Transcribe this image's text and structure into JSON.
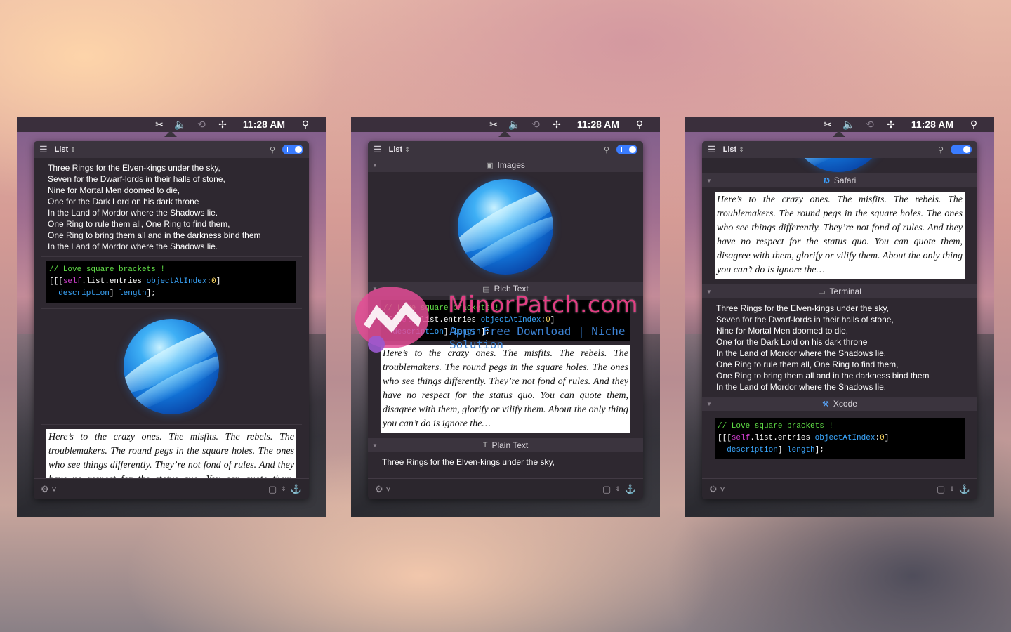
{
  "menubar": {
    "time": "11:28 AM"
  },
  "panel": {
    "title": "List"
  },
  "poem": [
    "Three Rings for the Elven-kings under the sky,",
    "Seven for the Dwarf-lords in their halls of stone,",
    "Nine for Mortal Men doomed to die,",
    "One for the Dark Lord on his dark throne",
    "In the Land of Mordor where the Shadows lie.",
    "One Ring to rule them all, One Ring to find them,",
    "One Ring to bring them all and in the darkness bind them",
    "In the Land of Mordor where the Shadows lie."
  ],
  "code": {
    "comment": "// Love square brackets !",
    "l2_open": "[[[",
    "l2_self": "self",
    "l2_mid": ".list.entries ",
    "l2_sel": "objectAtIndex",
    "l2_colon": ":",
    "l2_num": "0",
    "l2_close": "]",
    "l3_desc": "description",
    "l3_mid": "] ",
    "l3_len": "length",
    "l3_end": "];"
  },
  "rich_text": "Here’s to the crazy ones. The misfits. The rebels. The troublemakers. The round pegs in the square holes. The ones who see things differently. They’re not fond of rules. And they have no respect for the status quo. You can quote them, disagree with them, glorify or vilify them. About the only thing you can’t do is ignore the…",
  "sections": {
    "images": "Images",
    "rich_text": "Rich Text",
    "plain_text": "Plain Text",
    "safari": "Safari",
    "terminal": "Terminal",
    "xcode": "Xcode"
  },
  "watermark": {
    "title": "MinorPatch.com",
    "subtitle": "Apps Free Download | Niche Solution"
  },
  "colors": {
    "accent": "#3a7cff",
    "watermark_pink": "#e23d83",
    "watermark_blue": "#3b80d0"
  }
}
